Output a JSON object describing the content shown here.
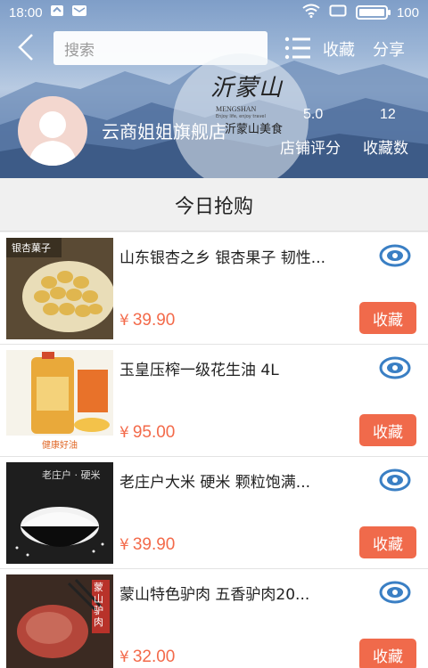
{
  "status_bar": {
    "time": "18:00",
    "battery_level": 100,
    "battery_text": "100"
  },
  "header": {
    "search_placeholder": "搜索",
    "favorite_label": "收藏",
    "share_label": "分享"
  },
  "store": {
    "name": "云商姐姐旗舰店",
    "logo_text": "沂蒙山",
    "logo_en": "MENGSHAN",
    "logo_tagline": "Enjoy life, enjoy travel",
    "logo_overlay_text": "沂蒙山美食",
    "rating_value": "5.0",
    "rating_label": "店铺评分",
    "favorites_value": "12",
    "favorites_label": "收藏数"
  },
  "section_title": "今日抢购",
  "products": [
    {
      "name": "山东银杏之乡 银杏果子 韧性...",
      "currency": "¥",
      "price": "39.90",
      "button": "收藏",
      "thumb_caption": "银杏菓子"
    },
    {
      "name": "玉皇压榨一级花生油  4L",
      "currency": "¥",
      "price": "95.00",
      "button": "收藏",
      "thumb_caption": "健康好油"
    },
    {
      "name": "老庄户大米 硬米  颗粒饱满...",
      "currency": "¥",
      "price": "39.90",
      "button": "收藏",
      "thumb_caption": "老庄户 · 硬米"
    },
    {
      "name": "蒙山特色驴肉  五香驴肉20...",
      "currency": "¥",
      "price": "32.00",
      "button": "收藏",
      "thumb_caption": "蒙山驴肉"
    }
  ],
  "colors": {
    "accent": "#f06a4b",
    "price": "#f36a4a",
    "icon_blue": "#3a7fc4"
  }
}
